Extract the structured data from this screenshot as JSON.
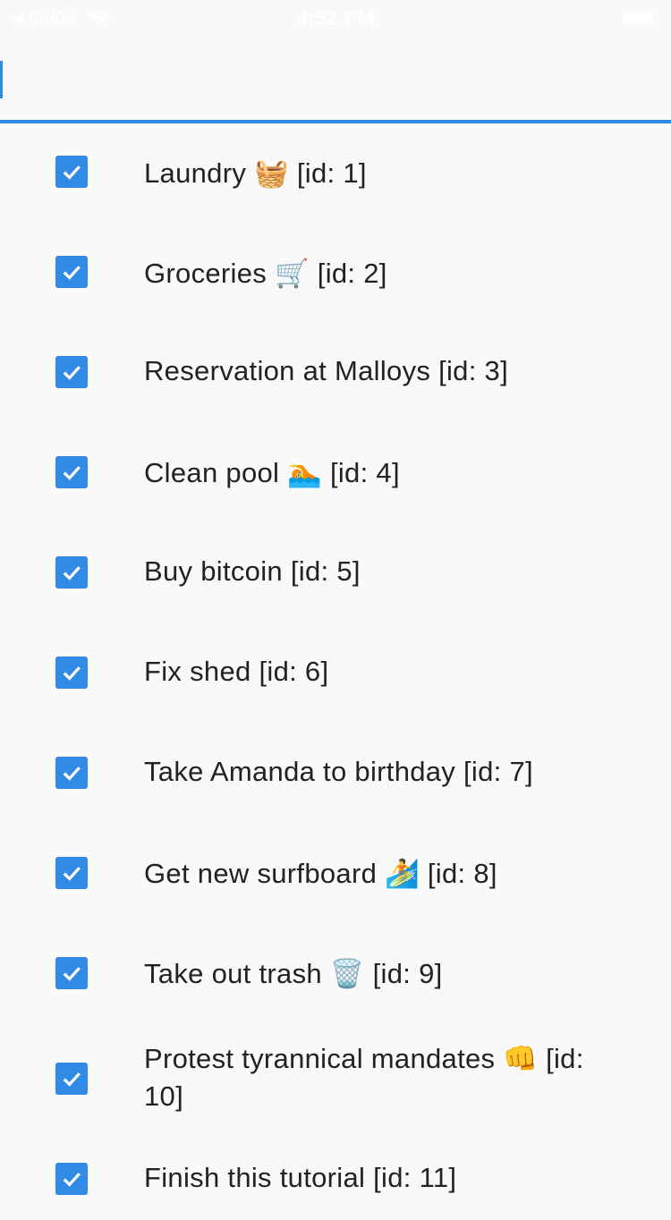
{
  "status_bar": {
    "back_arrow": "◀",
    "carrier": "todos",
    "time": "4:52 PM",
    "icons": [
      "back-arrow-icon",
      "wifi-icon",
      "battery-icon"
    ]
  },
  "new_todo": {
    "value": "",
    "placeholder": ""
  },
  "colors": {
    "accent": "#2f8be6",
    "background": "#f9f9fa",
    "text": "#222222"
  },
  "todos": [
    {
      "label": "Laundry 🧺 [id: 1]",
      "done": true
    },
    {
      "label": "Groceries 🛒 [id: 2]",
      "done": true
    },
    {
      "label": "Reservation at Malloys [id: 3]",
      "done": true
    },
    {
      "label": "Clean pool 🏊 [id: 4]",
      "done": true
    },
    {
      "label": "Buy bitcoin [id: 5]",
      "done": true
    },
    {
      "label": "Fix shed [id: 6]",
      "done": true
    },
    {
      "label": "Take Amanda to birthday [id: 7]",
      "done": true
    },
    {
      "label": "Get new surfboard 🏄 [id: 8]",
      "done": true
    },
    {
      "label": "Take out trash 🗑️ [id: 9]",
      "done": true
    },
    {
      "label": "Protest tyrannical mandates 👊 [id: 10]",
      "done": true
    },
    {
      "label": "Finish this tutorial [id: 11]",
      "done": true
    }
  ]
}
